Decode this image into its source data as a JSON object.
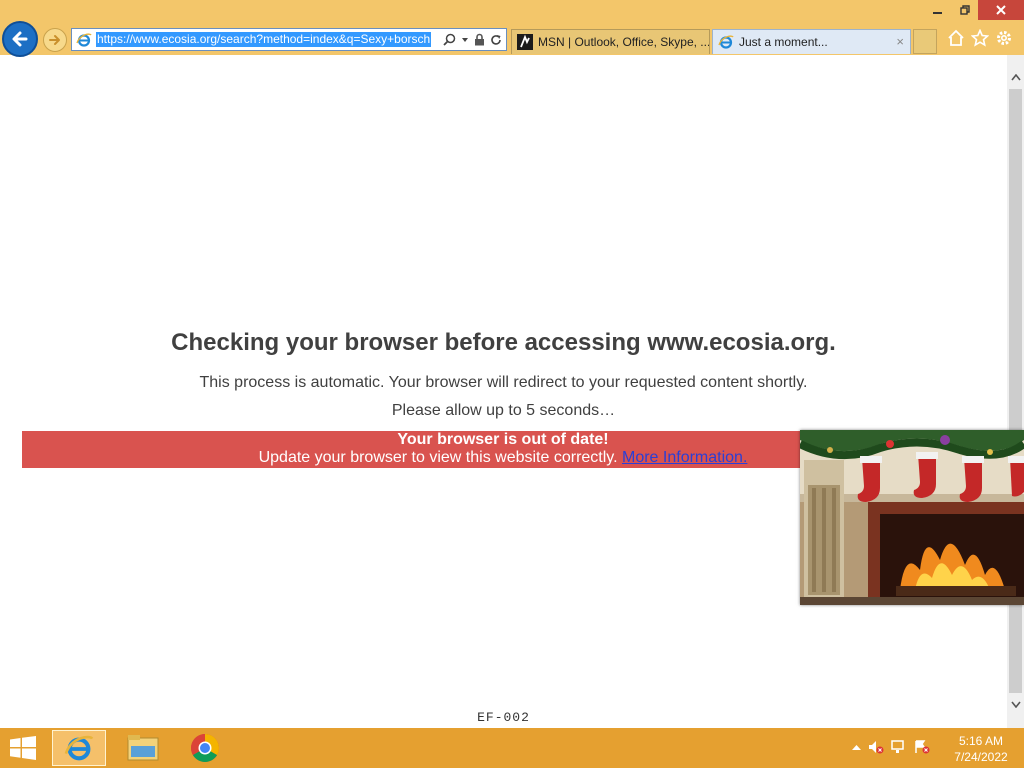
{
  "browser": {
    "address": "https://www.ecosia.org/search?method=index&q=Sexy+borsch",
    "tabs": [
      {
        "label": "MSN | Outlook, Office, Skype, ...",
        "icon": "msn-icon"
      },
      {
        "label": "Just a moment...",
        "icon": "ie-icon"
      }
    ],
    "tab_close": "×"
  },
  "page": {
    "heading": "Checking your browser before accessing www.ecosia.org.",
    "line1": "This process is automatic. Your browser will redirect to your requested content shortly.",
    "line2": "Please allow up to 5 seconds…",
    "banner": {
      "title": "Your browser is out of date!",
      "text": "Update your browser to view this website correctly. ",
      "link": "More Information."
    },
    "code": "EF-002"
  },
  "taskbar": {
    "time": "5:16 AM",
    "date": "7/24/2022"
  },
  "colors": {
    "chrome": "#f3c66a",
    "banner": "#d9534f",
    "taskbar": "#e5a030",
    "accent_blue": "#1d6fc4"
  }
}
